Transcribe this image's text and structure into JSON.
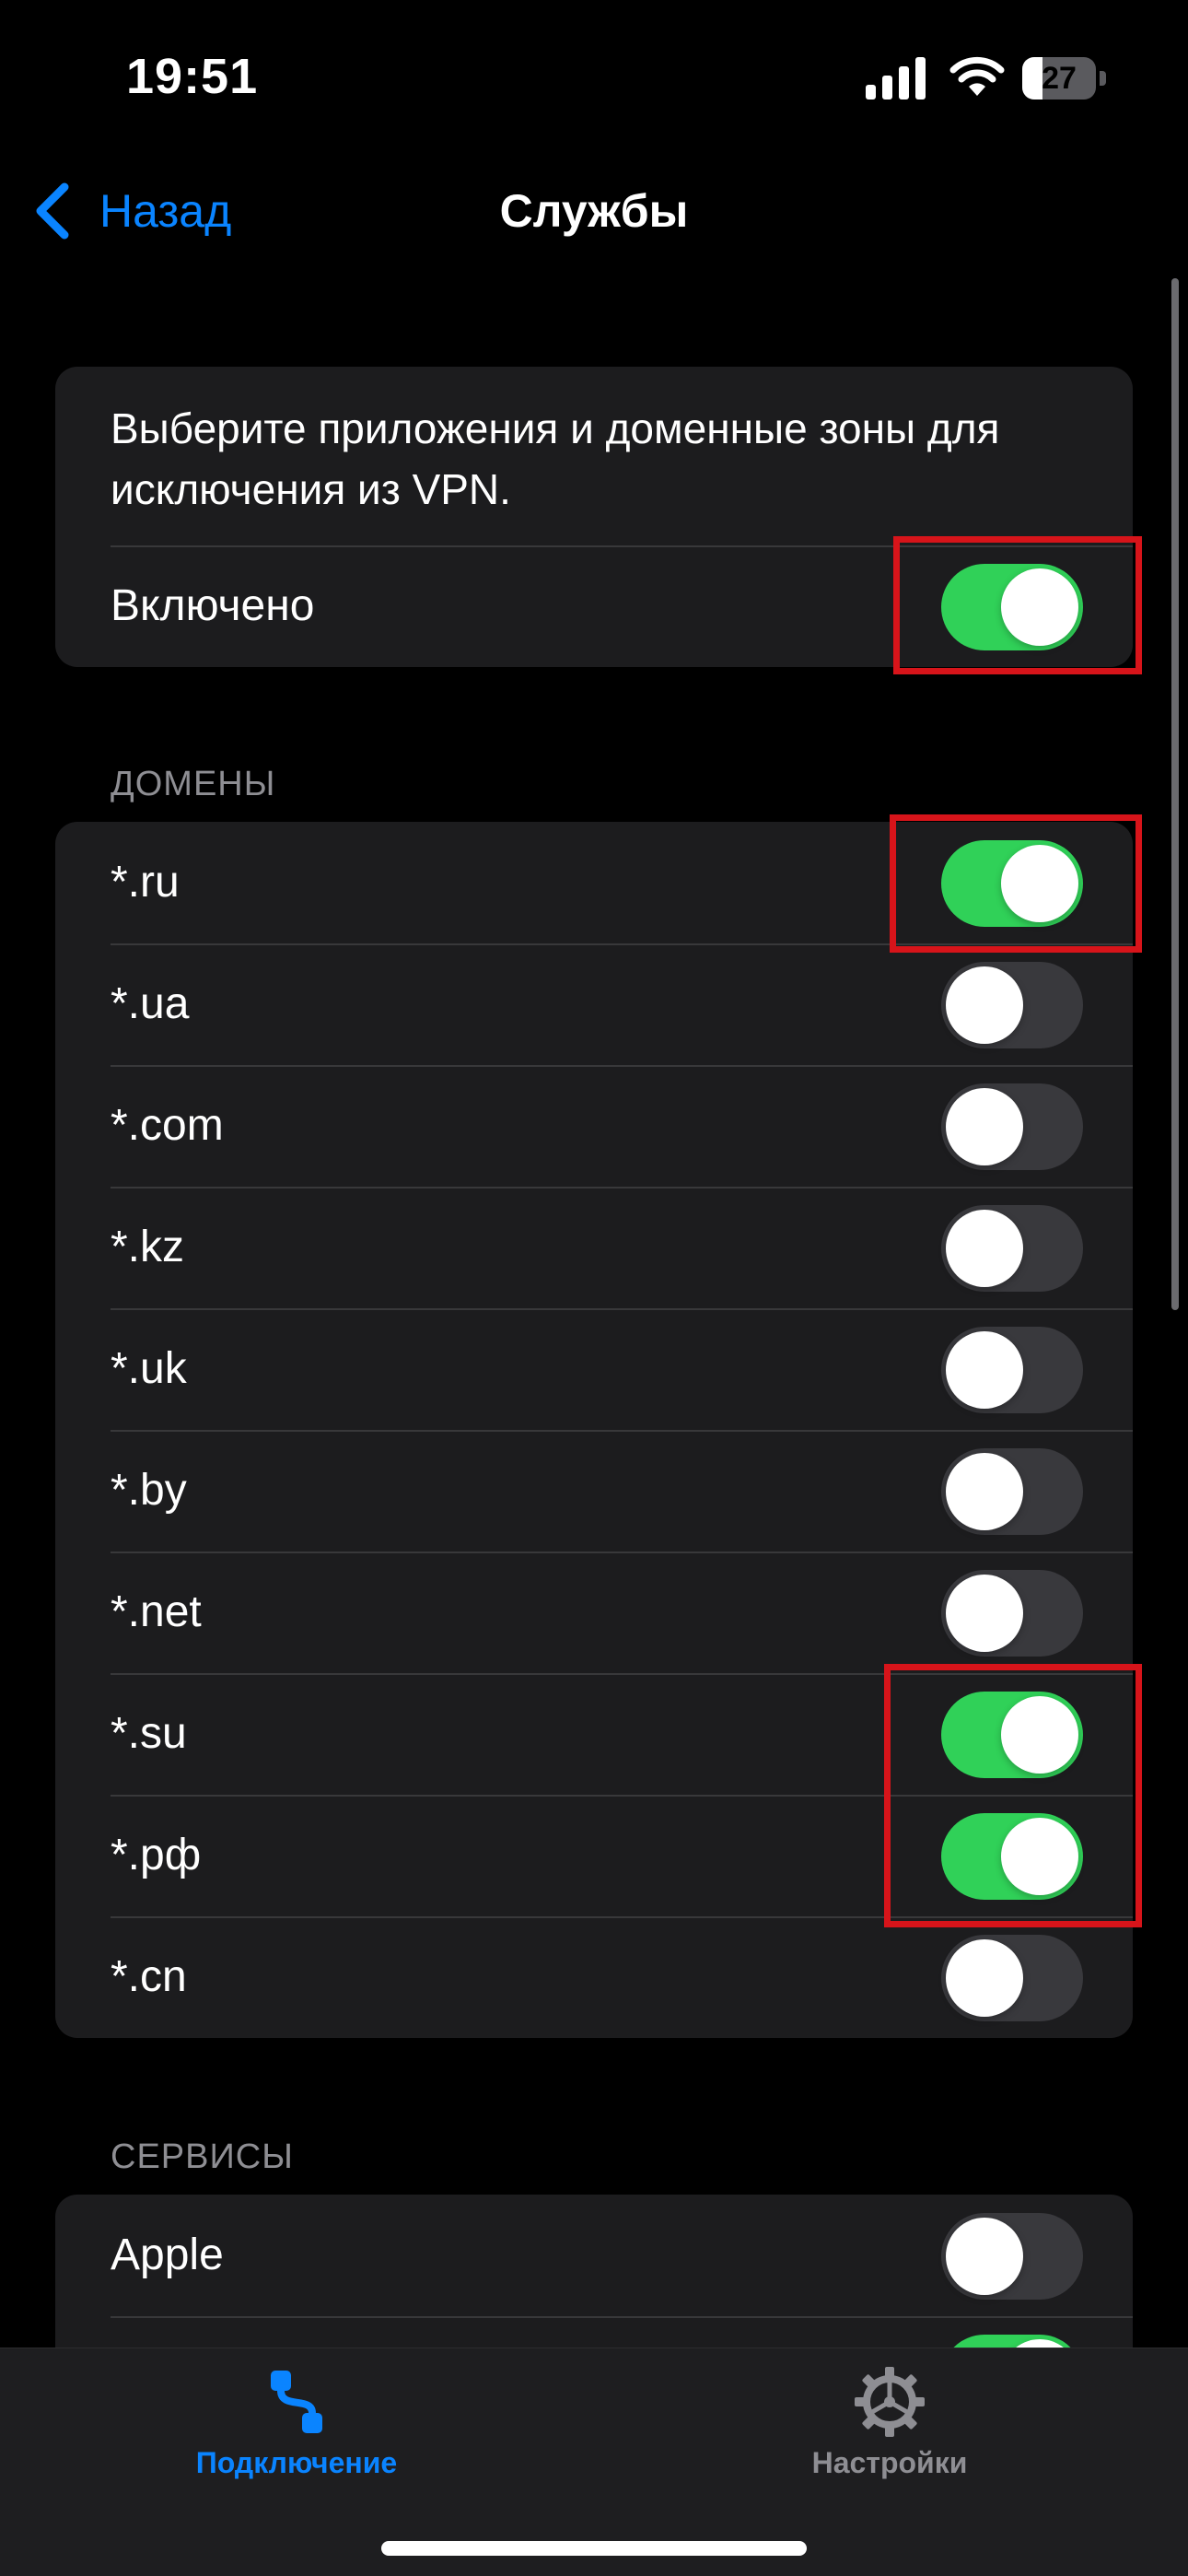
{
  "status_bar": {
    "time": "19:51",
    "battery": "27",
    "battery_level": 0.27
  },
  "nav": {
    "back_label": "Назад",
    "title": "Службы"
  },
  "info_card": {
    "description": "Выберите приложения и доменные зоны для исключения из VPN.",
    "enabled_label": "Включено",
    "enabled": true
  },
  "domains": {
    "header": "ДОМЕНЫ",
    "items": [
      {
        "label": "*.ru",
        "on": true
      },
      {
        "label": "*.ua",
        "on": false
      },
      {
        "label": "*.com",
        "on": false
      },
      {
        "label": "*.kz",
        "on": false
      },
      {
        "label": "*.uk",
        "on": false
      },
      {
        "label": "*.by",
        "on": false
      },
      {
        "label": "*.net",
        "on": false
      },
      {
        "label": "*.su",
        "on": true
      },
      {
        "label": "*.рф",
        "on": true
      },
      {
        "label": "*.cn",
        "on": false
      }
    ]
  },
  "services": {
    "header": "СЕРВИСЫ",
    "items": [
      {
        "label": "Apple",
        "on": false
      },
      {
        "label": "",
        "on": true
      }
    ]
  },
  "tab_bar": {
    "tabs": [
      {
        "label": "Подключение",
        "icon": "route-icon",
        "active": true
      },
      {
        "label": "Настройки",
        "icon": "gear-icon",
        "active": false
      }
    ]
  },
  "colors": {
    "accent": "#0a84ff",
    "toggle_on": "#30d158",
    "toggle_off": "#39393d",
    "highlight": "#d7141a",
    "card": "#1c1c1e"
  }
}
